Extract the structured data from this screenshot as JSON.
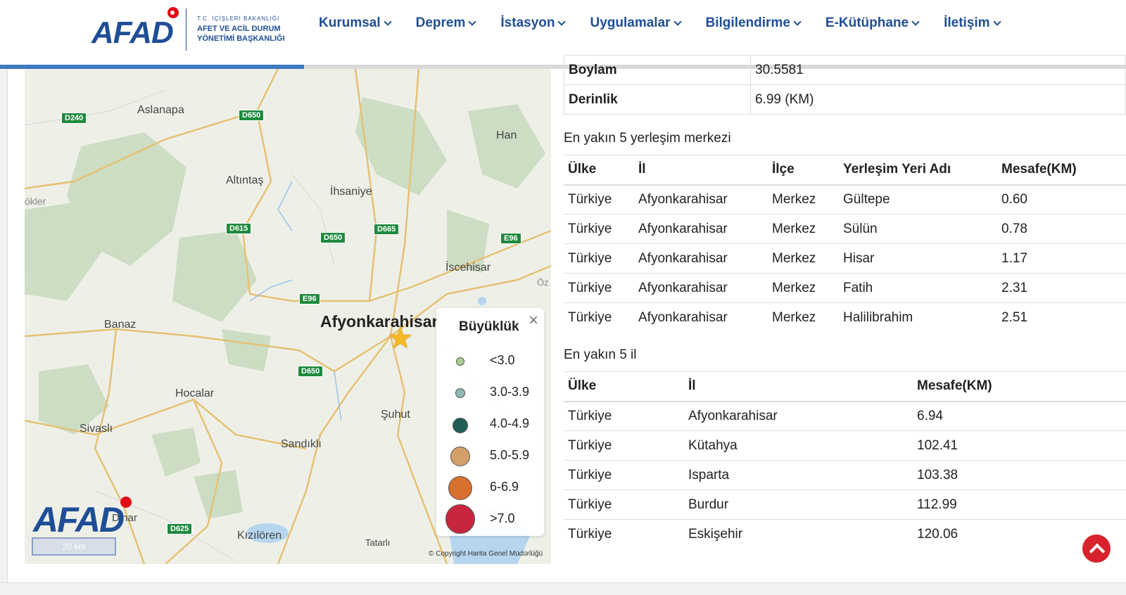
{
  "header": {
    "logo_text": "AFAD",
    "logo_sub_small": "T.C. İÇİŞLERİ BAKANLIĞI",
    "logo_sub_1": "AFET VE ACİL DURUM",
    "logo_sub_2": "YÖNETİMİ BAŞKANLIĞI",
    "nav": [
      {
        "label": "Kurumsal"
      },
      {
        "label": "Deprem"
      },
      {
        "label": "İstasyon"
      },
      {
        "label": "Uygulamalar"
      },
      {
        "label": "Bilgilendirme"
      },
      {
        "label": "E-Kütüphane"
      },
      {
        "label": "İletişim"
      }
    ],
    "scroll_progress": 0.27
  },
  "map": {
    "places": [
      {
        "name": "Aslanapa"
      },
      {
        "name": "Han"
      },
      {
        "name": "Altıntaş"
      },
      {
        "name": "İhsaniye"
      },
      {
        "name": "İscehisar"
      },
      {
        "name": "Banaz"
      },
      {
        "name": "Afyonkarahisar"
      },
      {
        "name": "Hocalar"
      },
      {
        "name": "Şuhut"
      },
      {
        "name": "Sivaslı"
      },
      {
        "name": "Sandıklı"
      },
      {
        "name": "Kızılören"
      },
      {
        "name": "Tatarlı"
      },
      {
        "name": "ökler"
      },
      {
        "name": "Öz"
      },
      {
        "name": "Dinar"
      }
    ],
    "roads": [
      "D240",
      "D650",
      "D615",
      "D650",
      "D665",
      "E96",
      "E96",
      "D650",
      "D625"
    ],
    "logo_text": "AFAD",
    "scale_label": "20 km",
    "copyright": "© Copyright Harita Genel Müdürlüğü",
    "legend": {
      "title": "Büyüklük",
      "close": "×",
      "items": [
        {
          "label": "<3.0",
          "color": "#a8d08d"
        },
        {
          "label": "3.0-3.9",
          "color": "#8fb8b4"
        },
        {
          "label": "4.0-4.9",
          "color": "#1f5e55"
        },
        {
          "label": "5.0-5.9",
          "color": "#d3a06a"
        },
        {
          "label": "6-6.9",
          "color": "#d8702e"
        },
        {
          "label": ">7.0",
          "color": "#c7263e"
        }
      ]
    }
  },
  "details": {
    "boylam_label": "Boylam",
    "boylam_value": "30.5581",
    "derinlik_label": "Derinlik",
    "derinlik_value": "6.99 (KM)"
  },
  "settlements": {
    "title": "En yakın 5 yerleşim merkezi",
    "headers": [
      "Ülke",
      "İl",
      "İlçe",
      "Yerleşim Yeri Adı",
      "Mesafe(KM)"
    ],
    "rows": [
      [
        "Türkiye",
        "Afyonkarahisar",
        "Merkez",
        "Gültepe",
        "0.60"
      ],
      [
        "Türkiye",
        "Afyonkarahisar",
        "Merkez",
        "Sülün",
        "0.78"
      ],
      [
        "Türkiye",
        "Afyonkarahisar",
        "Merkez",
        "Hisar",
        "1.17"
      ],
      [
        "Türkiye",
        "Afyonkarahisar",
        "Merkez",
        "Fatih",
        "2.31"
      ],
      [
        "Türkiye",
        "Afyonkarahisar",
        "Merkez",
        "Halilibrahim",
        "2.51"
      ]
    ]
  },
  "provinces": {
    "title": "En yakın 5 il",
    "headers": [
      "Ülke",
      "İl",
      "Mesafe(KM)"
    ],
    "rows": [
      [
        "Türkiye",
        "Afyonkarahisar",
        "6.94"
      ],
      [
        "Türkiye",
        "Kütahya",
        "102.41"
      ],
      [
        "Türkiye",
        "Isparta",
        "103.38"
      ],
      [
        "Türkiye",
        "Burdur",
        "112.99"
      ],
      [
        "Türkiye",
        "Eskişehir",
        "120.06"
      ]
    ]
  }
}
